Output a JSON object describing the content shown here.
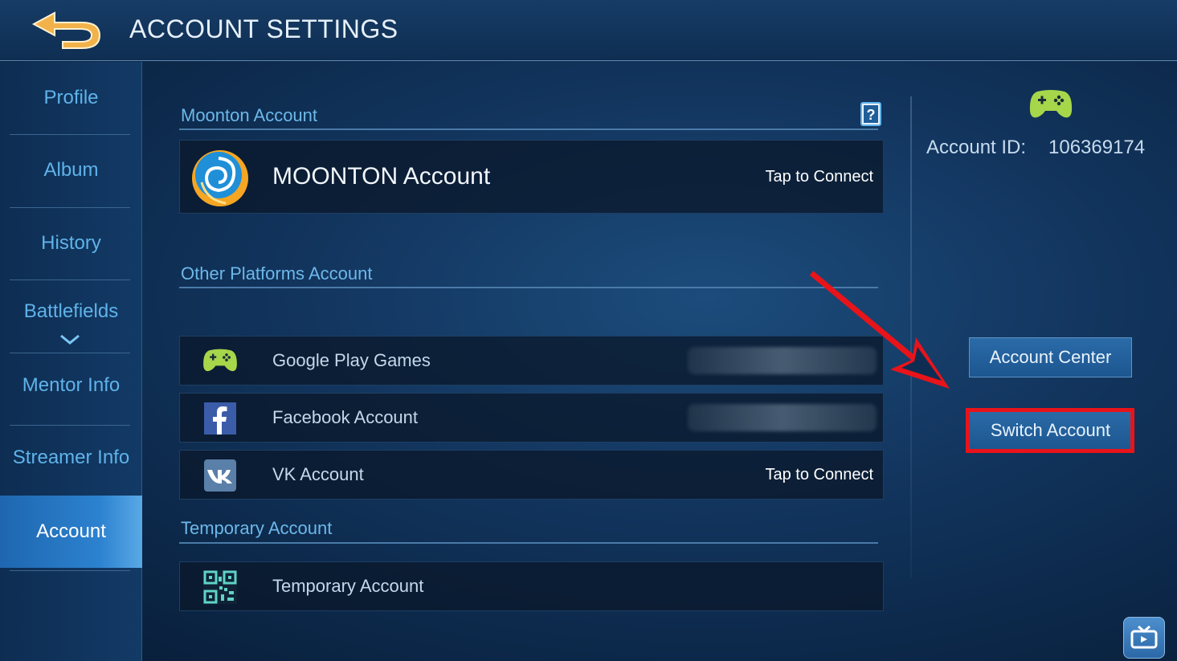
{
  "header": {
    "title": "ACCOUNT SETTINGS"
  },
  "sidebar": {
    "items": [
      {
        "label": "Profile"
      },
      {
        "label": "Album"
      },
      {
        "label": "History"
      },
      {
        "label": "Battlefields"
      },
      {
        "label": "Mentor Info"
      },
      {
        "label": "Streamer Info"
      },
      {
        "label": "Account",
        "active": true
      }
    ]
  },
  "sections": {
    "moonton": {
      "title": "Moonton Account",
      "row": {
        "label": "MOONTON Account",
        "action": "Tap to Connect",
        "icon": "moonton-logo-icon"
      }
    },
    "other": {
      "title": "Other Platforms Account",
      "rows": [
        {
          "label": "Google Play Games",
          "icon": "gamepad-icon"
        },
        {
          "label": "Facebook Account",
          "icon": "facebook-icon"
        },
        {
          "label": "VK Account",
          "action": "Tap to Connect",
          "icon": "vk-icon"
        }
      ]
    },
    "temporary": {
      "title": "Temporary Account",
      "row": {
        "label": "Temporary Account",
        "icon": "qr-code-icon"
      }
    }
  },
  "account": {
    "id_label": "Account ID:",
    "id_value": "106369174",
    "center_button": "Account Center",
    "switch_button": "Switch Account"
  },
  "colors": {
    "accent_text": "#6db8ea",
    "highlight": "#e8141a",
    "gamepad": "#a6d64a",
    "button": "#2a6ba8"
  }
}
